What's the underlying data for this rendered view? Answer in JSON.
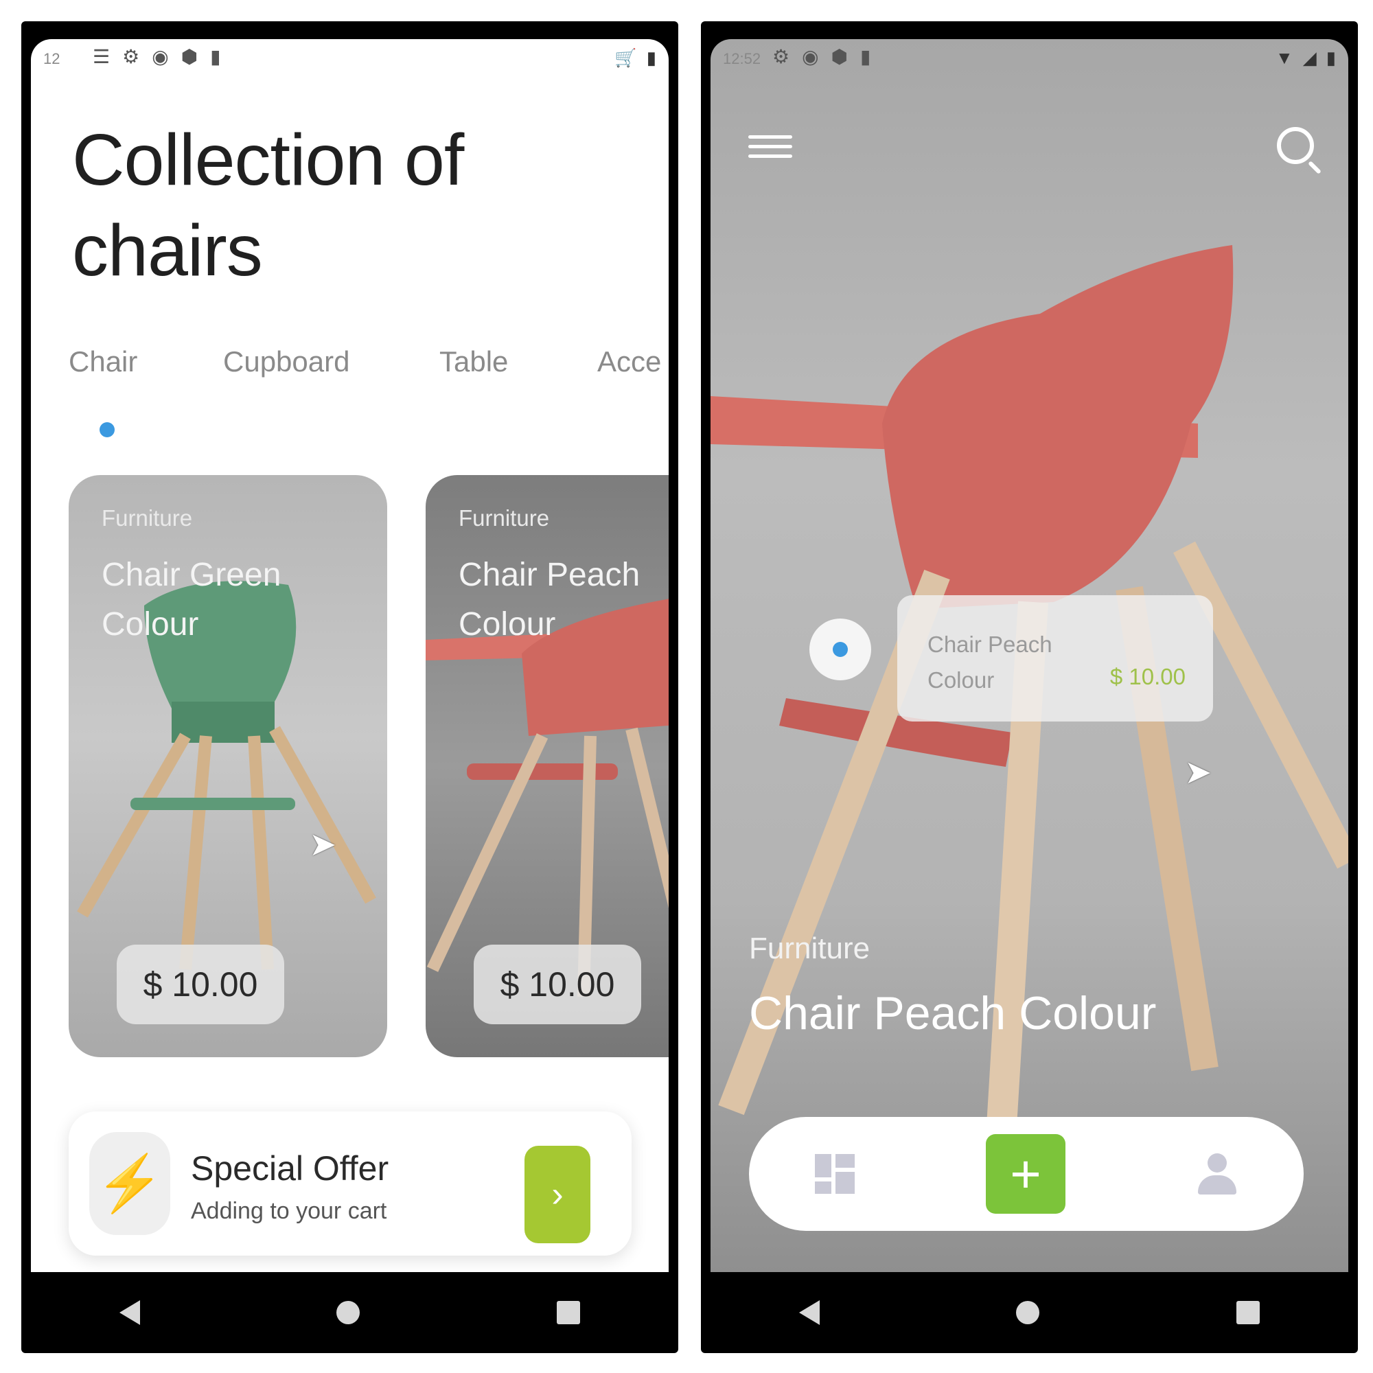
{
  "left_screen": {
    "status_time": "12",
    "title": "Collection of chairs",
    "tabs": [
      "Chair",
      "Cupboard",
      "Table",
      "Acce"
    ],
    "cards": [
      {
        "category": "Furniture",
        "name": "Chair Green Colour",
        "price": "$ 10.00"
      },
      {
        "category": "Furniture",
        "name": "Chair Peach Colour",
        "price": "$ 10.00"
      }
    ],
    "offer": {
      "title": "Special Offer",
      "subtitle": "Adding to your cart",
      "arrow": "›"
    }
  },
  "right_screen": {
    "status_time": "12:52",
    "tooltip": {
      "name": "Chair Peach Colour",
      "price": "$ 10.00"
    },
    "hero": {
      "category": "Furniture",
      "name": "Chair Peach Colour"
    },
    "bottom_nav": {
      "add": "+"
    }
  },
  "colors": {
    "accent_green": "#a5c832",
    "dot_blue": "#3b99e0",
    "add_green": "#7cc43a"
  },
  "icons": [
    "menu-icon",
    "search-icon",
    "cart-icon",
    "dashboard-icon",
    "add-icon",
    "user-icon",
    "lightning-icon",
    "chevron-right-icon"
  ]
}
